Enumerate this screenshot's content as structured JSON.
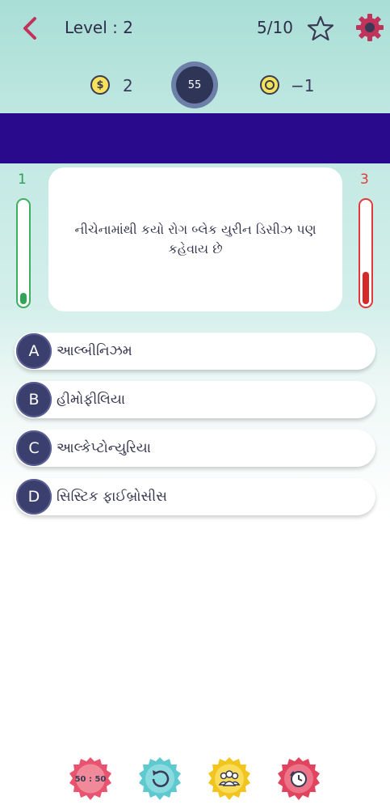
{
  "header": {
    "level_text": "Level : 2",
    "progress_text": "5/10",
    "icons": [
      "chevron-left-icon",
      "star-icon",
      "gear-icon"
    ]
  },
  "stats": {
    "coins": "2",
    "coin_symbol": "$",
    "timer": "55",
    "score": "−1"
  },
  "colors": {
    "banner": "#2a0a8c",
    "correct": "#2fa556",
    "wrong": "#d62a2a",
    "accent": "#c2335c",
    "option_letter_bg": "#3b3f6e"
  },
  "counters": {
    "correct": "1",
    "wrong": "3"
  },
  "question": {
    "text": "નીચેનામાંથી કયો રોગ બ્લેક યુરીન ડિસીઝ પણ કહેવાય છે"
  },
  "options": [
    {
      "letter": "A",
      "text": "આલ્બીનિઝમ"
    },
    {
      "letter": "B",
      "text": "હીમોફીલિયા"
    },
    {
      "letter": "C",
      "text": "આલ્કેપ્ટોન્યુરિયા"
    },
    {
      "letter": "D",
      "text": "સિસ્ટિક ફાઈબ્રોસીસ"
    }
  ],
  "lifelines": {
    "fifty_fifty_label": "50 : 50",
    "items": [
      "fifty-fifty-icon",
      "flip-question-icon",
      "audience-poll-icon",
      "time-rewind-icon"
    ]
  }
}
